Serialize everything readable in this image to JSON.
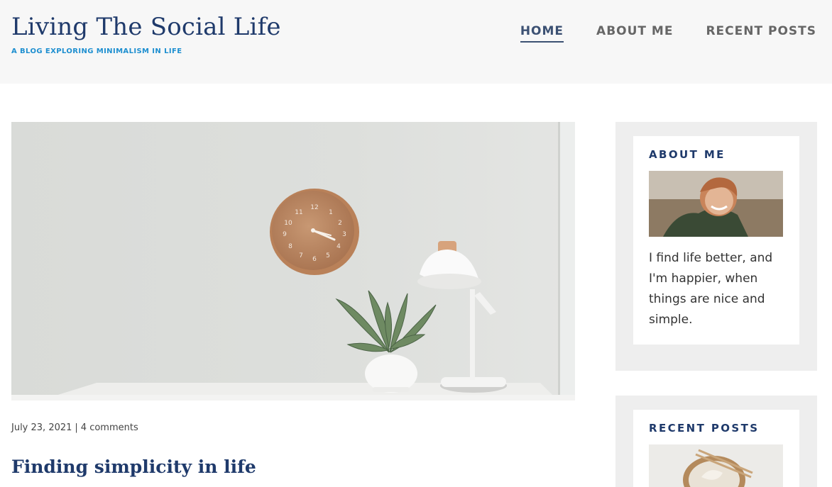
{
  "site": {
    "title": "Living The Social Life",
    "tagline": "A BLOG EXPLORING MINIMALISM IN LIFE"
  },
  "nav": {
    "items": [
      {
        "label": "HOME",
        "active": true
      },
      {
        "label": "ABOUT ME",
        "active": false
      },
      {
        "label": "RECENT POSTS",
        "active": false
      }
    ]
  },
  "post": {
    "date": "July 23, 2021",
    "separator": "|",
    "comments": "4 comments",
    "title": "Finding simplicity in life",
    "image": "hero-image-clock-plant-lamp"
  },
  "sidebar": {
    "about": {
      "title": "ABOUT ME",
      "image": "about-photo-smiling-person",
      "text": "I find life better, and I'm happier, when things are nice and simple."
    },
    "recent": {
      "title": "RECENT POSTS",
      "image": "recent-post-photo-bowl-chopsticks"
    }
  },
  "colors": {
    "brand": "#1f3a6b",
    "tagline": "#1e8fd0",
    "header_bg": "#f7f7f7",
    "sidebar_bg": "#eeeeee"
  }
}
